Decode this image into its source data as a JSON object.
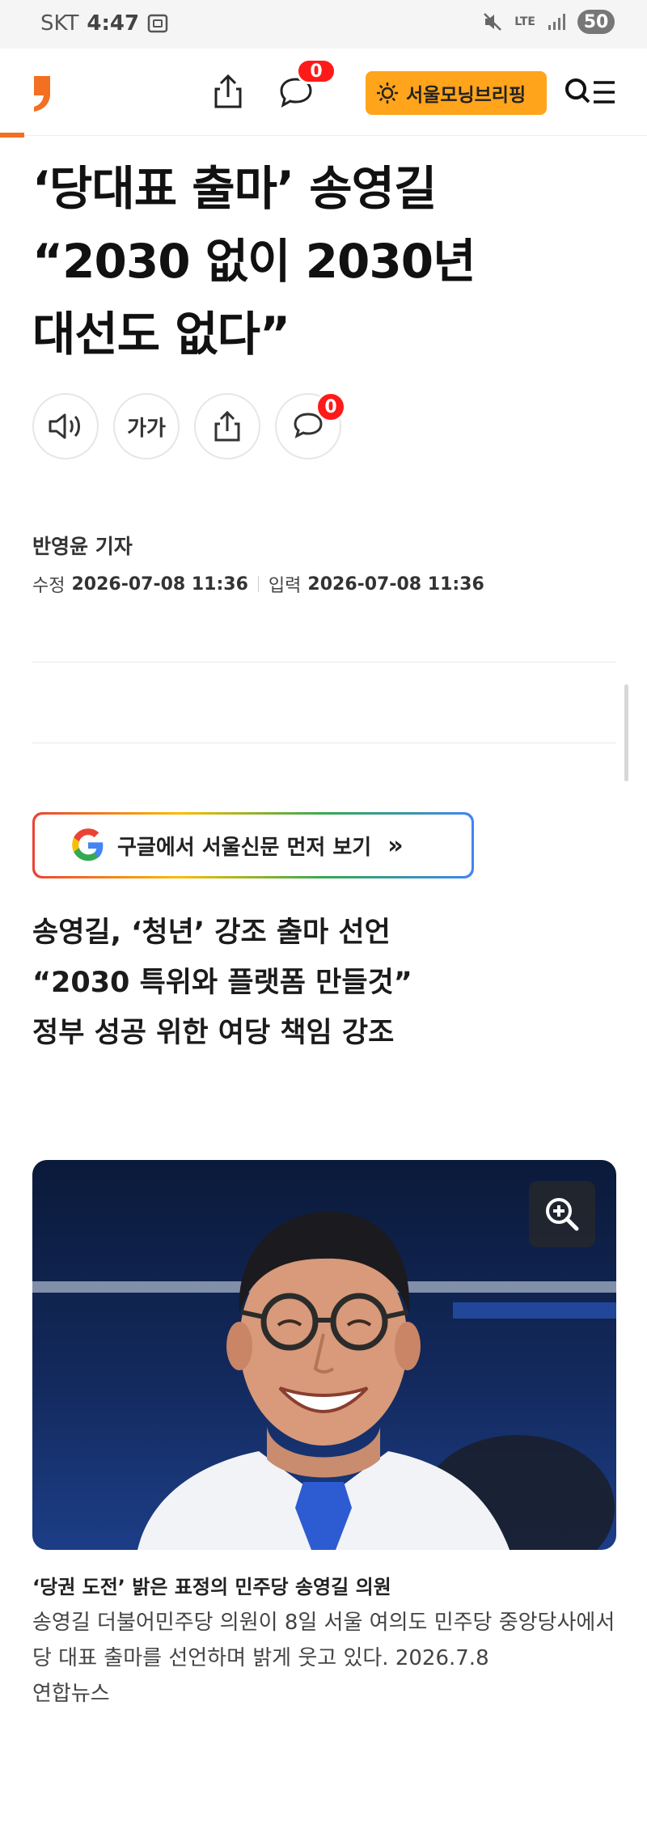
{
  "status_bar": {
    "carrier": "SKT",
    "time": "4:47",
    "network": "LTE",
    "battery": "50"
  },
  "header": {
    "comment_count": "0",
    "briefing_label": "서울모닝브리핑",
    "brand_color": "#f36f21",
    "briefing_color": "#ffa41b",
    "badge_color": "#ff1a1a"
  },
  "article": {
    "headline_lines": [
      "‘당대표 출마’ 송영길",
      "“2030 없이 2030년",
      "대선도 없다”"
    ],
    "font_size_label": "가가",
    "comment_count": "0",
    "reporter": "반영윤 기자",
    "modified_label": "수정",
    "modified_date": "2026-07-08 11:36",
    "published_label": "입력",
    "published_date": "2026-07-08 11:36",
    "google_button_label": "구글에서 서울신문 먼저 보기",
    "google_button_arrow": "»",
    "subheads": [
      "송영길, ‘청년’ 강조 출마 선언",
      "“2030 특위와 플랫폼 만들것”",
      "정부 성공 위한 여당 책임 강조"
    ],
    "photo": {
      "caption_title": "‘당권 도전’ 밝은 표정의 민주당 송영길 의원",
      "caption_body": "송영길 더불어민주당 의원이 8일 서울 여의도 민주당 중앙당사에서 당 대표 출마를 선언하며 밝게 웃고 있다. 2026.7.8",
      "credit": "연합뉴스"
    }
  }
}
